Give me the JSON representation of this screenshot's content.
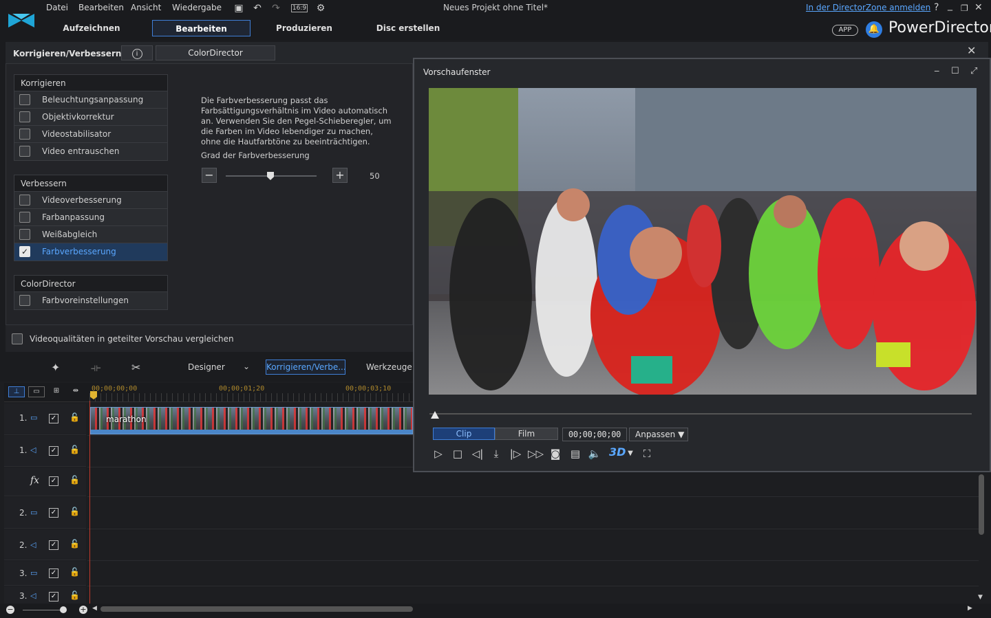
{
  "menu": [
    "Datei",
    "Bearbeiten",
    "Ansicht",
    "Wiedergabe"
  ],
  "toolbar_icons": [
    "save-icon",
    "undo-icon",
    "redo-icon",
    "aspect-ratio-icon",
    "settings-icon"
  ],
  "aspect_ratio": "16:9",
  "project_title": "Neues Projekt ohne Titel*",
  "login_link": "In der DirectorZone anmelden",
  "window_controls": {
    "help": "?",
    "minimize": "_",
    "restore": "❐",
    "close": "✕"
  },
  "modes": [
    {
      "label": "Aufzeichnen",
      "active": false
    },
    {
      "label": "Bearbeiten",
      "active": true
    },
    {
      "label": "Produzieren",
      "active": false
    },
    {
      "label": "Disc erstellen",
      "active": false
    }
  ],
  "app_badge": "APP",
  "brand": "PowerDirector",
  "panel": {
    "title": "Korrigieren/Verbessern",
    "info": "i",
    "colordirector_button": "ColorDirector",
    "close": "✕"
  },
  "groups": [
    {
      "head": "Korrigieren",
      "items": [
        {
          "label": "Beleuchtungsanpassung",
          "checked": false
        },
        {
          "label": "Objektivkorrektur",
          "checked": false
        },
        {
          "label": "Videostabilisator",
          "checked": false
        },
        {
          "label": "Video entrauschen",
          "checked": false
        }
      ]
    },
    {
      "head": "Verbessern",
      "items": [
        {
          "label": "Videoverbesserung",
          "checked": false
        },
        {
          "label": "Farbanpassung",
          "checked": false
        },
        {
          "label": "Weißabgleich",
          "checked": false
        },
        {
          "label": "Farbverbesserung",
          "checked": true
        }
      ]
    },
    {
      "head": "ColorDirector",
      "items": [
        {
          "label": "Farbvoreinstellungen",
          "checked": false
        }
      ]
    }
  ],
  "description": "Die Farbverbesserung passt das Farbsättigungsverhältnis im Video automatisch an. Verwenden Sie den Pegel-Schieberegler, um die Farben im Video lebendiger zu machen, ohne die Hautfarbtöne zu beeinträchtigen.",
  "slider": {
    "label": "Grad der Farbverbesserung",
    "minus": "−",
    "plus": "+",
    "value": 50,
    "min": 0,
    "max": 100
  },
  "compare": {
    "label": "Videoqualitäten in geteilter Vorschau vergleichen",
    "checked": false
  },
  "tools": {
    "designer": "Designer",
    "korrigieren": "Korrigieren/Verbe...",
    "werkzeuge": "Werkzeuge"
  },
  "timecodes": [
    "00;00;00;00",
    "00;00;01;20",
    "00;00;03;10"
  ],
  "tracks": [
    {
      "num": "1.",
      "type": "video",
      "checked": true
    },
    {
      "num": "1.",
      "type": "audio",
      "checked": true
    },
    {
      "num": "",
      "type": "fx",
      "checked": true
    },
    {
      "num": "2.",
      "type": "video",
      "checked": true
    },
    {
      "num": "2.",
      "type": "audio",
      "checked": true
    },
    {
      "num": "3.",
      "type": "video",
      "checked": true
    },
    {
      "num": "3.",
      "type": "audio",
      "checked": true
    }
  ],
  "clip_label": "marathon",
  "preview": {
    "title": "Vorschaufenster",
    "clip": "Clip",
    "film": "Film",
    "time": "00;00;00;00",
    "fit": "Anpassen",
    "three_d": "3D"
  },
  "colors": {
    "accent": "#3f7fd8",
    "link": "#5aa7ff",
    "playhead": "#c0392b"
  }
}
